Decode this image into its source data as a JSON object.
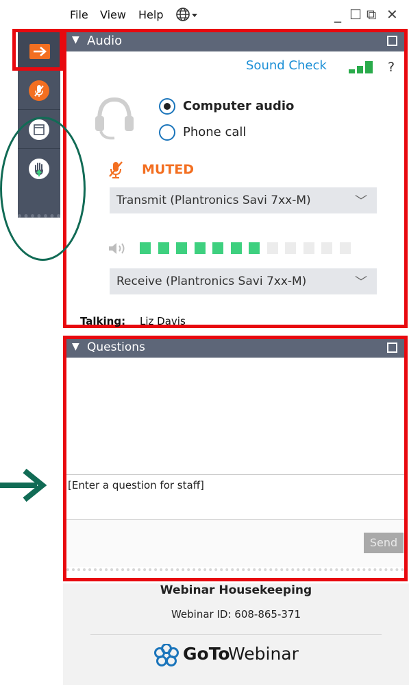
{
  "menu": {
    "file": "File",
    "view": "View",
    "help": "Help"
  },
  "window_controls": {
    "minimize": "_",
    "restore": "☐",
    "popout": "⧉",
    "close": "✕"
  },
  "audio": {
    "title": "Audio",
    "sound_check": "Sound Check",
    "help": "?",
    "options": [
      "Computer audio",
      "Phone call"
    ],
    "selected": "Computer audio",
    "muted_label": "MUTED",
    "transmit_device": "Transmit (Plantronics Savi 7xx-M)",
    "receive_device": "Receive (Plantronics Savi 7xx-M)",
    "output_level": 0.583,
    "talking_label": "Talking:",
    "talking_name": "Liz Davis"
  },
  "questions": {
    "title": "Questions",
    "placeholder": "[Enter a question for staff]",
    "send_label": "Send"
  },
  "footer": {
    "title": "Webinar Housekeeping",
    "webinar_id": "Webinar ID: 608-865-371",
    "brand_goto": "GoTo",
    "brand_webinar": "Webinar"
  },
  "colors": {
    "annotation_red": "#e8090f",
    "annotation_green": "#116b55",
    "header_gray": "#5d6678",
    "accent_orange": "#f36f21",
    "level_green": "#3ed07f",
    "link_blue": "#1b75bb"
  }
}
